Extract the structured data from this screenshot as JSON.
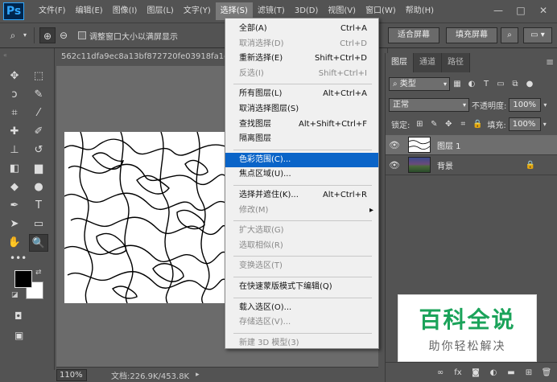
{
  "app": {
    "logo": "Ps"
  },
  "menubar": {
    "items": [
      "文件(F)",
      "编辑(E)",
      "图像(I)",
      "图层(L)",
      "文字(Y)",
      "选择(S)",
      "滤镜(T)",
      "3D(D)",
      "视图(V)",
      "窗口(W)",
      "帮助(H)"
    ],
    "active_index": 5,
    "window_controls": {
      "minimize": "—",
      "maximize": "□",
      "close": "✕"
    }
  },
  "options_bar": {
    "tool_icon": "zoom-icon",
    "resize_windows_label": "调整窗口大小以满屏显示",
    "fit_screen_label": "适合屏幕",
    "fill_screen_label": "填充屏幕"
  },
  "toolbar": {
    "tools": [
      {
        "name": "move-tool-icon",
        "glyph": "✥"
      },
      {
        "name": "marquee-tool-icon",
        "glyph": "⬚"
      },
      {
        "name": "lasso-tool-icon",
        "glyph": "ↄ"
      },
      {
        "name": "quick-select-tool-icon",
        "glyph": "✎"
      },
      {
        "name": "crop-tool-icon",
        "glyph": "⌗"
      },
      {
        "name": "eyedropper-tool-icon",
        "glyph": "⁄"
      },
      {
        "name": "healing-brush-tool-icon",
        "glyph": "✚"
      },
      {
        "name": "brush-tool-icon",
        "glyph": "✐"
      },
      {
        "name": "stamp-tool-icon",
        "glyph": "⊥"
      },
      {
        "name": "history-brush-tool-icon",
        "glyph": "↺"
      },
      {
        "name": "eraser-tool-icon",
        "glyph": "◧"
      },
      {
        "name": "gradient-tool-icon",
        "glyph": "▆"
      },
      {
        "name": "blur-tool-icon",
        "glyph": "◆"
      },
      {
        "name": "dodge-tool-icon",
        "glyph": "●"
      },
      {
        "name": "pen-tool-icon",
        "glyph": "✒"
      },
      {
        "name": "type-tool-icon",
        "glyph": "T"
      },
      {
        "name": "path-select-tool-icon",
        "glyph": "➤"
      },
      {
        "name": "shape-tool-icon",
        "glyph": "▭"
      },
      {
        "name": "hand-tool-icon",
        "glyph": "✋"
      },
      {
        "name": "zoom-tool-icon",
        "glyph": "🔍"
      }
    ],
    "foreground_color": "#000000",
    "background_color": "#ffffff"
  },
  "document": {
    "tab_title": "562c11dfa9ec8a13bf872720fe03918fa1ec...",
    "zoom": "110%",
    "doc_info": "文档:226.9K/453.8K"
  },
  "select_menu": {
    "items": [
      {
        "label": "全部(A)",
        "shortcut": "Ctrl+A",
        "disabled": false
      },
      {
        "label": "取消选择(D)",
        "shortcut": "Ctrl+D",
        "disabled": true
      },
      {
        "label": "重新选择(E)",
        "shortcut": "Shift+Ctrl+D",
        "disabled": false
      },
      {
        "label": "反选(I)",
        "shortcut": "Shift+Ctrl+I",
        "disabled": true
      },
      {
        "label": "所有图层(L)",
        "shortcut": "Alt+Ctrl+A",
        "disabled": false
      },
      {
        "label": "取消选择图层(S)",
        "shortcut": "",
        "disabled": false
      },
      {
        "label": "查找图层",
        "shortcut": "Alt+Shift+Ctrl+F",
        "disabled": false
      },
      {
        "label": "隔离图层",
        "shortcut": "",
        "disabled": false
      },
      {
        "label": "色彩范围(C)...",
        "shortcut": "",
        "disabled": false,
        "highlight": true
      },
      {
        "label": "焦点区域(U)...",
        "shortcut": "",
        "disabled": false
      },
      {
        "label": "选择并遮住(K)...",
        "shortcut": "Alt+Ctrl+R",
        "disabled": false
      },
      {
        "label": "修改(M)",
        "shortcut": "",
        "disabled": true,
        "submenu": true
      },
      {
        "label": "扩大选取(G)",
        "shortcut": "",
        "disabled": true
      },
      {
        "label": "选取相似(R)",
        "shortcut": "",
        "disabled": true
      },
      {
        "label": "变换选区(T)",
        "shortcut": "",
        "disabled": true
      },
      {
        "label": "在快速蒙版模式下编辑(Q)",
        "shortcut": "",
        "disabled": false
      },
      {
        "label": "载入选区(O)...",
        "shortcut": "",
        "disabled": false
      },
      {
        "label": "存储选区(V)...",
        "shortcut": "",
        "disabled": true
      },
      {
        "label": "新建 3D 模型(3)",
        "shortcut": "",
        "disabled": true
      }
    ]
  },
  "layers_panel": {
    "tabs": [
      "图层",
      "通道",
      "路径"
    ],
    "active_tab": 0,
    "filter_label": "类型",
    "blend_mode": "正常",
    "opacity_label": "不透明度:",
    "opacity_value": "100%",
    "lock_label": "锁定:",
    "fill_label": "填充:",
    "fill_value": "100%",
    "layers": [
      {
        "name": "图层 1",
        "selected": true,
        "locked": false
      },
      {
        "name": "背景",
        "selected": false,
        "locked": true
      }
    ]
  },
  "watermark": {
    "title": "百科全说",
    "subtitle": "助你轻松解决"
  }
}
